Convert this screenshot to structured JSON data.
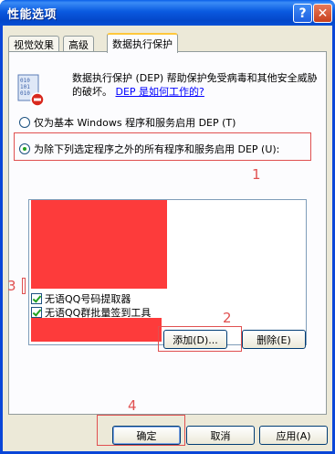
{
  "window": {
    "title": "性能选项"
  },
  "titlebar": {
    "help_glyph": "?",
    "close_glyph": "✕"
  },
  "tabs": [
    {
      "label": "视觉效果",
      "active": false
    },
    {
      "label": "高级",
      "active": false
    },
    {
      "label": "数据执行保护",
      "active": true
    }
  ],
  "dep": {
    "description": "数据执行保护 (DEP) 帮助保护免受病毒和其他安全威胁的破坏。",
    "link": "DEP 是如何工作的?",
    "option_basic": "仅为基本 Windows 程序和服务启用 DEP (T)",
    "option_all_except": "为除下列选定程序之外的所有程序和服务启用 DEP (U):",
    "selected_option": "all_except"
  },
  "exceptions": {
    "items": [
      {
        "label": "无语QQ号码提取器",
        "checked": true
      },
      {
        "label": "无语QQ群批量签到工具",
        "checked": true
      }
    ]
  },
  "buttons": {
    "add": "添加(D)...",
    "remove": "删除(E)",
    "ok": "确定",
    "cancel": "取消",
    "apply": "应用(A)"
  },
  "annotations": {
    "n1": "1",
    "n2": "2",
    "n3": "3",
    "n4": "4",
    "color": "#e05050"
  },
  "colors": {
    "redaction": "#fd3b3b",
    "title_bar": "#0a5ae0",
    "dialog_bg": "#ece9d8"
  }
}
